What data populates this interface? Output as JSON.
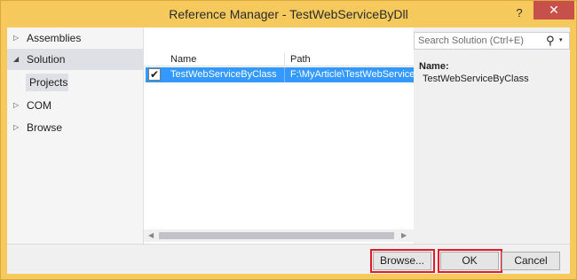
{
  "window": {
    "title": "Reference Manager - TestWebServiceByDll",
    "help_label": "?",
    "close_label": "✕"
  },
  "sidebar": {
    "items": [
      {
        "label": "Assemblies",
        "expanded": false,
        "arrow": "▷"
      },
      {
        "label": "Solution",
        "expanded": true,
        "arrow": "◢",
        "selected": true
      },
      {
        "label": "COM",
        "expanded": false,
        "arrow": "▷"
      },
      {
        "label": "Browse",
        "expanded": false,
        "arrow": "▷"
      }
    ],
    "subitem": "Projects"
  },
  "list": {
    "columns": [
      "Name",
      "Path"
    ],
    "rows": [
      {
        "checked": true,
        "check_glyph": "✔",
        "name": "TestWebServiceByClass",
        "path": "F:\\MyArticle\\TestWebService"
      }
    ],
    "scroll_left": "◀",
    "scroll_right": "▶"
  },
  "search": {
    "placeholder": "Search Solution (Ctrl+E)",
    "icon": "search-icon",
    "icon_glyph": "⚲",
    "dropdown_glyph": "▾"
  },
  "details": {
    "name_label": "Name:",
    "name_value": "TestWebServiceByClass"
  },
  "footer": {
    "browse_label": "Browse...",
    "ok_label": "OK",
    "cancel_label": "Cancel"
  },
  "colors": {
    "frame": "#f5c95c",
    "selection": "#3399ff",
    "highlight_box": "#e21b2b",
    "close_button": "#c7504a"
  }
}
